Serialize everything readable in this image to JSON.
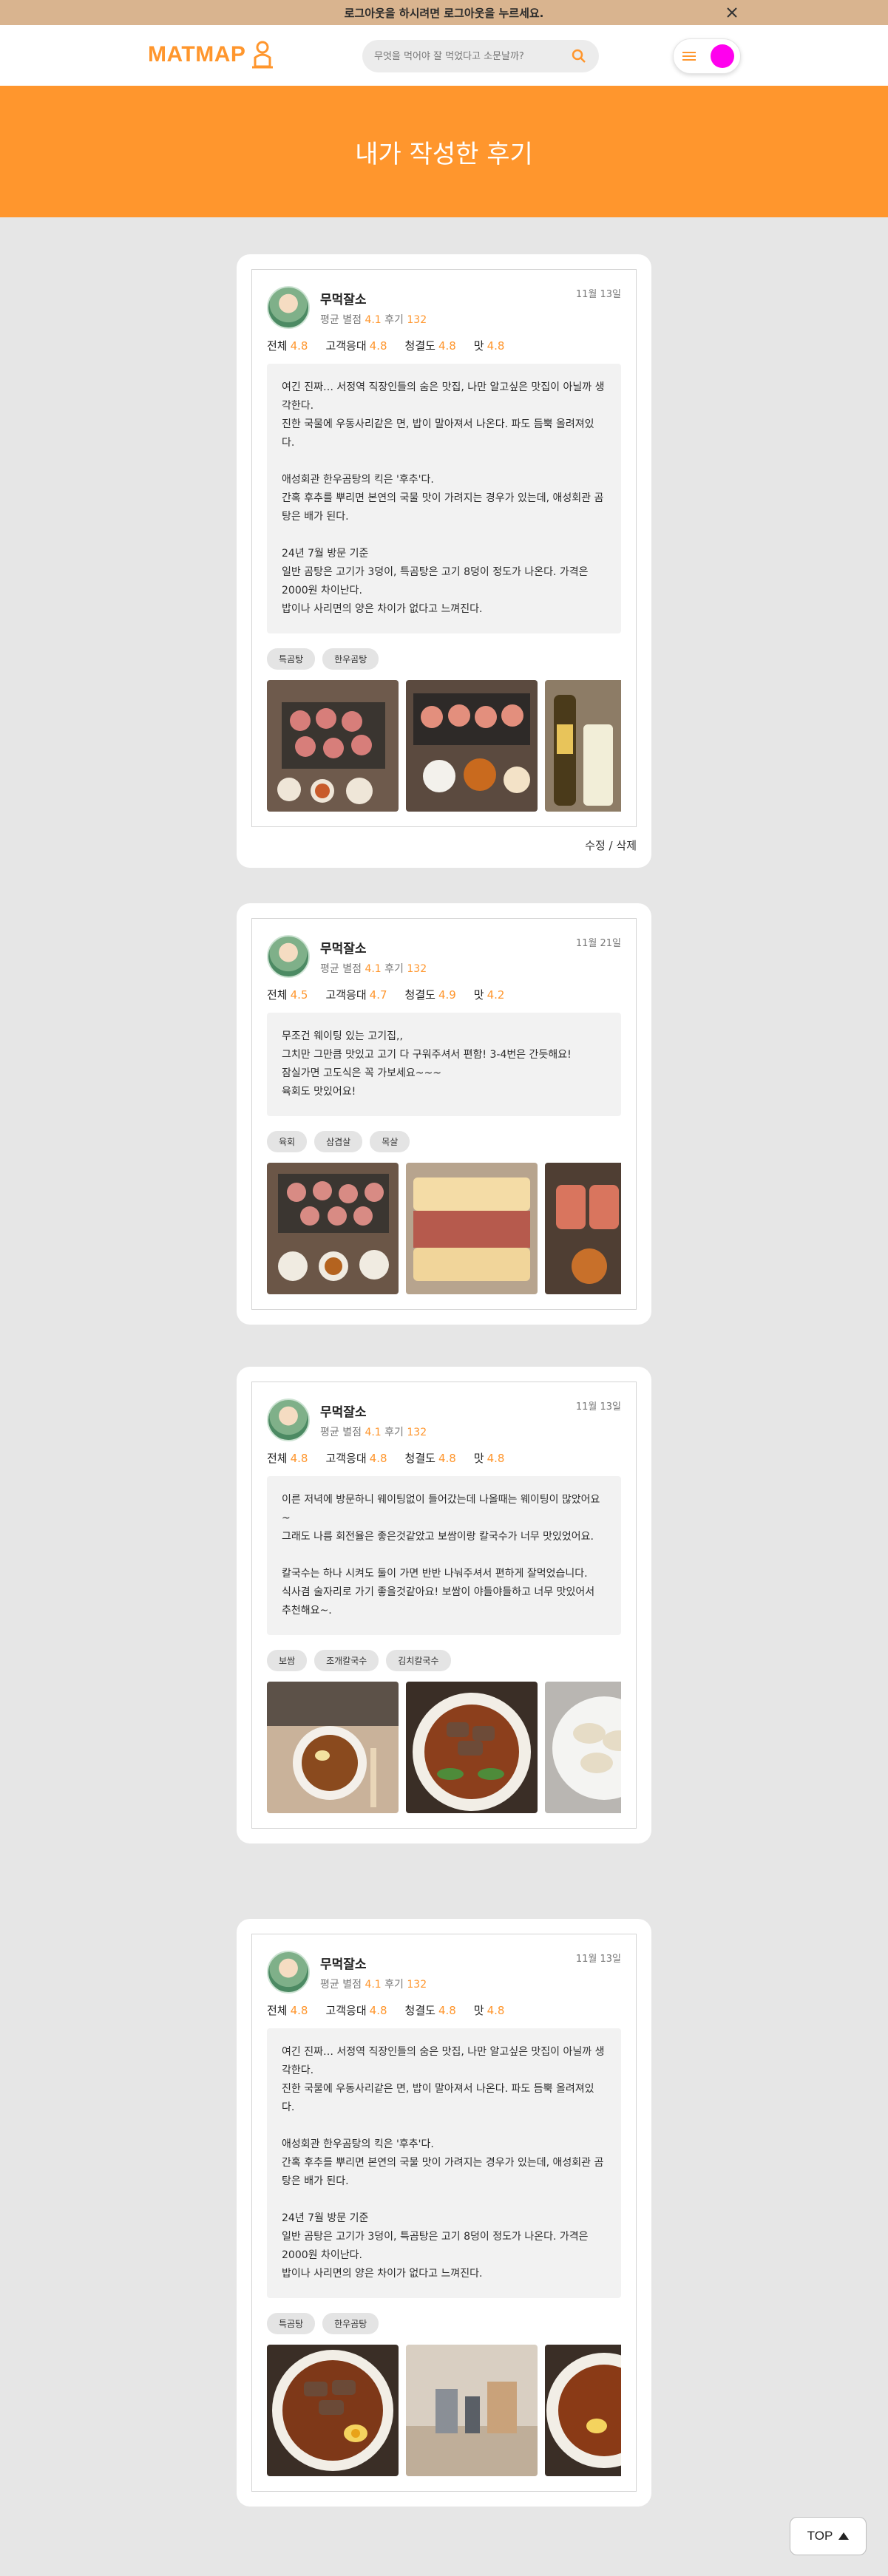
{
  "notice": {
    "text": "로그아웃을 하시려면 로그아웃을 누르세요."
  },
  "header": {
    "logo": "MATMAP",
    "search_placeholder": "무엇을 먹어야 잘 먹었다고 소문날까?"
  },
  "hero": {
    "title": "내가 작성한 후기"
  },
  "colors": {
    "accent": "#ff962d",
    "notice_bg": "#d9b48f",
    "avatar": "#ff00ee"
  },
  "reviews": [
    {
      "user": "무먹잘소",
      "avg_label": "평균 별점",
      "avg": "4.1",
      "count_label": "후기",
      "count": "132",
      "date": "11월 13일",
      "scores": [
        {
          "label": "전체",
          "value": "4.8"
        },
        {
          "label": "고객응대",
          "value": "4.8"
        },
        {
          "label": "청결도",
          "value": "4.8"
        },
        {
          "label": "맛",
          "value": "4.8"
        }
      ],
      "content": "여긴 진짜… 서정역 직장인들의 숨은 맛집, 나만 알고싶은 맛집이 아닐까 생각한다.\n진한 국물에 우동사리같은 면, 밥이 말아져서 나온다. 파도 듬뿍 올려져있다.\n\n애성회관 한우곰탕의 킥은 '후추'다.\n간혹 후추를 뿌리면 본연의 국물 맛이 가려지는 경우가 있는데, 애성회관 곰탕은 배가 된다.\n\n24년 7월 방문 기준\n일반 곰탕은 고기가 3덩이, 특곰탕은 고기 8덩이 정도가 나온다. 가격은 2000원 차이난다.\n밥이나 사리면의 양은 차이가 없다고 느껴진다.",
      "tags": [
        "특곰탕",
        "한우곰탕"
      ],
      "photos": [
        "grilled-meat-table-photo",
        "pork-cutlet-set-photo",
        "bottle-drinks-photo"
      ],
      "actions": {
        "edit": "수정",
        "sep": "/",
        "delete": "삭제"
      }
    },
    {
      "user": "무먹잘소",
      "avg_label": "평균 별점",
      "avg": "4.1",
      "count_label": "후기",
      "count": "132",
      "date": "11월 21일",
      "scores": [
        {
          "label": "전체",
          "value": "4.5"
        },
        {
          "label": "고객응대",
          "value": "4.7"
        },
        {
          "label": "청결도",
          "value": "4.9"
        },
        {
          "label": "맛",
          "value": "4.2"
        }
      ],
      "content": "무조건 웨이팅 있는 고기집,,\n그치만 그만큼 맛있고 고기 다 구워주셔서 편함! 3-4번은 간듯해요!\n잠실가면 고도식은 꼭 가보세요~~~\n육회도 맛있어요!",
      "tags": [
        "육회",
        "삼겹살",
        "목살"
      ],
      "photos": [
        "grilled-meat-table-photo",
        "katsu-sandwich-photo",
        "pork-cutlet-set-photo"
      ]
    },
    {
      "user": "무먹잘소",
      "avg_label": "평균 별점",
      "avg": "4.1",
      "count_label": "후기",
      "count": "132",
      "date": "11월 13일",
      "scores": [
        {
          "label": "전체",
          "value": "4.8"
        },
        {
          "label": "고객응대",
          "value": "4.8"
        },
        {
          "label": "청결도",
          "value": "4.8"
        },
        {
          "label": "맛",
          "value": "4.8"
        }
      ],
      "content": "이른 저녁에 방문하니 웨이팅없이 들어갔는데 나올때는 웨이팅이 많았어요~\n그래도 나름 회전율은 좋은것같았고 보쌈이랑 칼국수가 너무 맛있었어요.\n\n칼국수는 하나 시켜도 둘이 가면 반반 나눠주셔서 편하게 잘먹었습니다.\n식사겸 술자리로 가기 좋을것같아요! 보쌈이 야들야들하고 너무 맛있어서 추천해요~.",
      "tags": [
        "보쌈",
        "조개칼국수",
        "김치칼국수"
      ],
      "photos": [
        "noodle-soup-table-photo",
        "beef-noodle-soup-photo",
        "dumplings-photo"
      ]
    },
    {
      "user": "무먹잘소",
      "avg_label": "평균 별점",
      "avg": "4.1",
      "count_label": "후기",
      "count": "132",
      "date": "11월 13일",
      "scores": [
        {
          "label": "전체",
          "value": "4.8"
        },
        {
          "label": "고객응대",
          "value": "4.8"
        },
        {
          "label": "청결도",
          "value": "4.8"
        },
        {
          "label": "맛",
          "value": "4.8"
        }
      ],
      "content": "여긴 진짜… 서정역 직장인들의 숨은 맛집, 나만 알고싶은 맛집이 아닐까 생각한다.\n진한 국물에 우동사리같은 면, 밥이 말아져서 나온다. 파도 듬뿍 올려져있다.\n\n애성회관 한우곰탕의 킥은 '후추'다.\n간혹 후추를 뿌리면 본연의 국물 맛이 가려지는 경우가 있는데, 애성회관 곰탕은 배가 된다.\n\n24년 7월 방문 기준\n일반 곰탕은 고기가 3덩이, 특곰탕은 고기 8덩이 정도가 나온다. 가격은 2000원 차이난다.\n밥이나 사리면의 양은 차이가 없다고 느껴진다.",
      "tags": [
        "특곰탕",
        "한우곰탕"
      ],
      "photos": [
        "beef-noodle-soup-photo",
        "restaurant-table-photo",
        "beef-noodle-soup-photo"
      ]
    }
  ],
  "top_button": {
    "label": "TOP"
  }
}
